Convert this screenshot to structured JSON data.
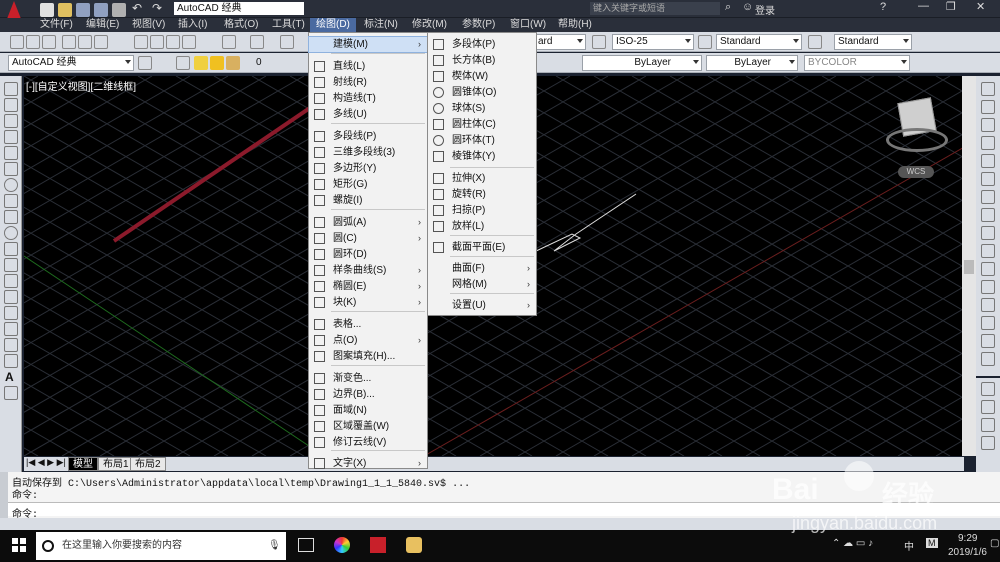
{
  "app": {
    "workspace_title": "AutoCAD 经典",
    "search_placeholder": "键入关键字或短语",
    "login": "登录"
  },
  "menubar": [
    {
      "label": "文件(F)"
    },
    {
      "label": "编辑(E)"
    },
    {
      "label": "视图(V)"
    },
    {
      "label": "插入(I)"
    },
    {
      "label": "格式(O)"
    },
    {
      "label": "工具(T)"
    },
    {
      "label": "绘图(D)"
    },
    {
      "label": "标注(N)"
    },
    {
      "label": "修改(M)"
    },
    {
      "label": "参数(P)"
    },
    {
      "label": "窗口(W)"
    },
    {
      "label": "帮助(H)"
    }
  ],
  "toolbar": {
    "workspace": "AutoCAD 经典",
    "layer_value": "0",
    "style1": "ard",
    "dimstyle": "ISO-25",
    "tablestyle": "Standard",
    "mleaderstyle": "Standard",
    "linetype": "ByLayer",
    "lineweight": "ByLayer",
    "plotstyle": "BYCOLOR"
  },
  "viewport": {
    "label": "[-][自定义视图][二维线框]",
    "wcs": "WCS"
  },
  "draw_menu": {
    "items": [
      {
        "label": "建模(M)",
        "sub": true
      },
      {
        "label": "直线(L)"
      },
      {
        "label": "射线(R)"
      },
      {
        "label": "构造线(T)"
      },
      {
        "label": "多线(U)"
      },
      {
        "label": "多段线(P)"
      },
      {
        "label": "三维多段线(3)"
      },
      {
        "label": "多边形(Y)"
      },
      {
        "label": "矩形(G)"
      },
      {
        "label": "螺旋(I)"
      },
      {
        "label": "圆弧(A)",
        "sub": true
      },
      {
        "label": "圆(C)",
        "sub": true
      },
      {
        "label": "圆环(D)"
      },
      {
        "label": "样条曲线(S)",
        "sub": true
      },
      {
        "label": "椭圆(E)",
        "sub": true
      },
      {
        "label": "块(K)",
        "sub": true
      },
      {
        "label": "表格..."
      },
      {
        "label": "点(O)",
        "sub": true
      },
      {
        "label": "图案填充(H)..."
      },
      {
        "label": "渐变色..."
      },
      {
        "label": "边界(B)..."
      },
      {
        "label": "面域(N)"
      },
      {
        "label": "区域覆盖(W)"
      },
      {
        "label": "修订云线(V)"
      },
      {
        "label": "文字(X)",
        "sub": true
      }
    ]
  },
  "modeling_menu": {
    "items": [
      {
        "label": "多段体(P)"
      },
      {
        "label": "长方体(B)"
      },
      {
        "label": "楔体(W)"
      },
      {
        "label": "圆锥体(O)"
      },
      {
        "label": "球体(S)"
      },
      {
        "label": "圆柱体(C)"
      },
      {
        "label": "圆环体(T)"
      },
      {
        "label": "棱锥体(Y)"
      },
      {
        "label": "拉伸(X)"
      },
      {
        "label": "旋转(R)"
      },
      {
        "label": "扫掠(P)"
      },
      {
        "label": "放样(L)"
      },
      {
        "label": "截面平面(E)"
      },
      {
        "label": "曲面(F)",
        "sub": true
      },
      {
        "label": "网格(M)",
        "sub": true
      },
      {
        "label": "设置(U)",
        "sub": true
      }
    ]
  },
  "tabs": [
    {
      "label": "模型"
    },
    {
      "label": "布局1"
    },
    {
      "label": "布局2"
    }
  ],
  "command": {
    "line1": "自动保存到 C:\\Users\\Administrator\\appdata\\local\\temp\\Drawing1_1_1_5840.sv$ ...",
    "line2": "命令:",
    "line3": "命令:"
  },
  "taskbar": {
    "search_placeholder": "在这里输入你要搜索的内容",
    "time": "9:29",
    "date": "2019/1/6",
    "ime": "中",
    "ime2": "M"
  },
  "watermark": {
    "brand": "Bai",
    "brand2": "经验",
    "url": "jingyan.baidu.com"
  },
  "colors": {
    "accent": "#4a6aa0",
    "arrow": "#8b1a2b",
    "canvas": "#000000"
  }
}
